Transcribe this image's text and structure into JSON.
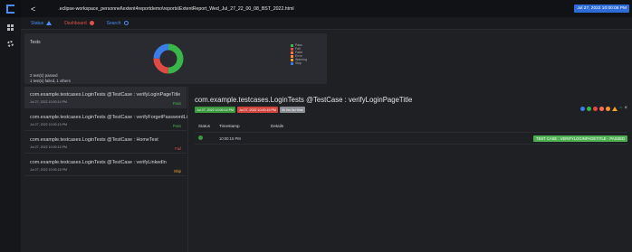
{
  "topbar": {
    "back_label": "<",
    "path": ".eclipse-workspace_personnel\\extent4reportdemo\\reports\\ExtentReport_Wed_Jul_27_22_00_08_BST_2022.html",
    "date": "Jul 27, 2022 10:00:08 PM"
  },
  "subbar": {
    "status_label": "Status",
    "dashboard_label": "Dashboard",
    "search_label": "Search"
  },
  "summary": {
    "title": "Tests",
    "passed_text": "2 test(s) passed",
    "failed_text": "1 test(s) failed, 1 others",
    "legend": [
      "Pass",
      "Fail",
      "Fatal",
      "Error",
      "Warning",
      "Skip"
    ],
    "colors": {
      "pass": "#3ab54a",
      "fail": "#e04a45",
      "fatal": "#ff6f4f",
      "error": "#ff8c33",
      "warning": "#f0a02f",
      "skip": "#3b7de8"
    }
  },
  "tests": [
    {
      "name": "com.example.testcases.LoginTests @TestCase : verifyLoginPageTitle",
      "time": "Jul 27, 2022 10:00:14 PM",
      "status": "Pass"
    },
    {
      "name": "com.example.testcases.LoginTests @TestCase : verifyForgetPasswordLink",
      "time": "Jul 27, 2022 10:00:15 PM",
      "status": "Pass"
    },
    {
      "name": "com.example.testcases.LoginTests @TestCase : HomeTest",
      "time": "Jul 27, 2022 10:00:15 PM",
      "status": "Fail"
    },
    {
      "name": "com.example.testcases.LoginTests @TestCase : verifyLinkedIn",
      "time": "Jul 27, 2022 10:00:16 PM",
      "status": "Skip"
    }
  ],
  "detail": {
    "title": "com.example.testcases.LoginTests @TestCase : verifyLoginPageTitle",
    "start_badge": "Jul 27, 2022 10:00:14 PM",
    "end_badge": "Jul 27, 2022 10:00:15 PM",
    "duration_badge": "0h 0m 0s+0ms",
    "columns": [
      "Status",
      "Timestamp",
      "Details"
    ],
    "row": {
      "time": "10:00:15 PM",
      "details": "TEST CASE : VERIFYLOGINPAGETITLE - PASSED"
    },
    "icon_colors": [
      "#3b7de8",
      "#3ab54a",
      "#e04a45",
      "#ff6f4f",
      "#ff8c33",
      "#f0a02f"
    ]
  }
}
